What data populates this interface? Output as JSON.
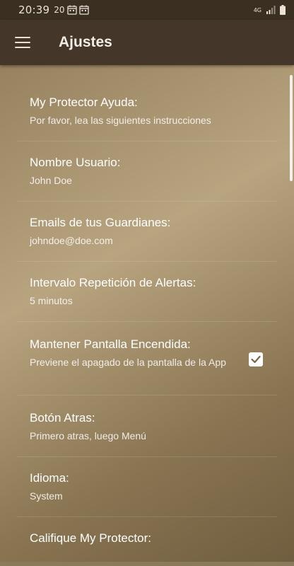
{
  "status_bar": {
    "time": "20:39",
    "notif_1": "20",
    "network": "4G"
  },
  "app_bar": {
    "title": "Ajustes"
  },
  "preferences": [
    {
      "title": "My Protector Ayuda:",
      "summary": "Por favor, lea las siguientes instrucciones"
    },
    {
      "title": "Nombre Usuario:",
      "summary": "John Doe"
    },
    {
      "title": "Emails de tus Guardianes:",
      "summary": "johndoe@doe.com"
    },
    {
      "title": "Intervalo Repetición de Alertas:",
      "summary": "5 minutos"
    },
    {
      "title": "Mantener Pantalla Encendida:",
      "summary": "Previene el apagado de la pantalla de la App",
      "checked": true
    },
    {
      "title": "Botón Atras:",
      "summary": "Primero atras, luego Menú"
    },
    {
      "title": "Idioma:",
      "summary": "System"
    },
    {
      "title": "Califique My Protector:",
      "summary": ""
    }
  ]
}
